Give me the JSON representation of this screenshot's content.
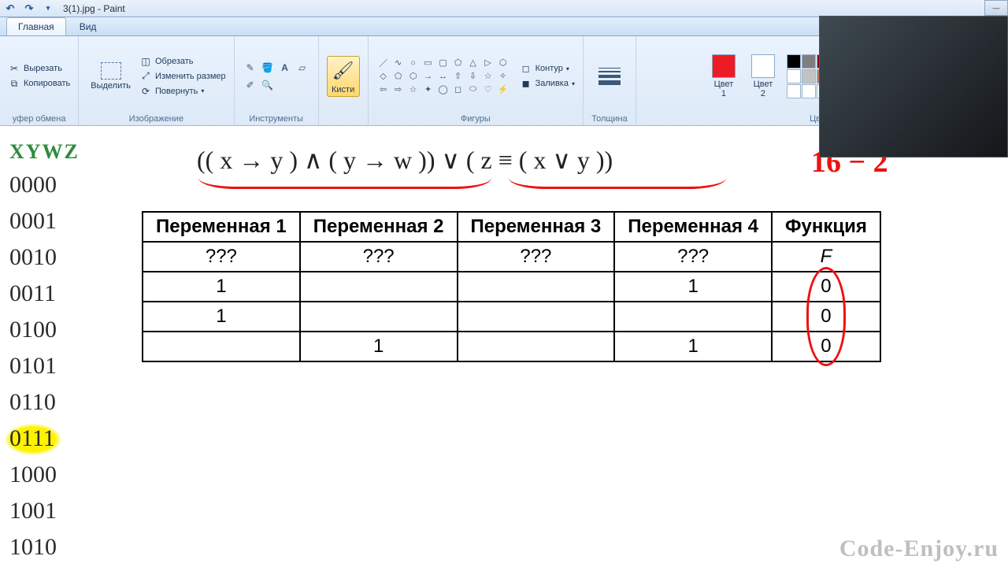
{
  "titlebar": {
    "title": "3(1).jpg - Paint"
  },
  "tabs": {
    "home": "Главная",
    "view": "Вид"
  },
  "ribbon": {
    "clipboard": {
      "label": "уфер обмена",
      "cut": "Вырезать",
      "copy": "Копировать"
    },
    "select": {
      "btn": "Выделить",
      "label": "Изображение",
      "crop": "Обрезать",
      "resize": "Изменить размер",
      "rotate": "Повернуть"
    },
    "tools": {
      "label": "Инструменты"
    },
    "brushes": {
      "btn": "Кисти"
    },
    "shapes": {
      "label": "Фигуры",
      "outline": "Контур",
      "fill": "Заливка"
    },
    "thickness": {
      "label": "Толщина"
    },
    "colors": {
      "c1": "Цвет\n1",
      "c2": "Цвет\n2",
      "label": "Цвета"
    }
  },
  "palette_row1": [
    "#000000",
    "#7f7f7f",
    "#880015",
    "#ed1c24",
    "#ff7f27",
    "#fff200",
    "#22b14c",
    "#00a2e8",
    "#3f48cc",
    "#a349a4"
  ],
  "palette_row2": [
    "#ffffff",
    "#c3c3c3",
    "#b97a57",
    "#ffaec9",
    "#ffc90e",
    "#efe4b0",
    "#b5e61d",
    "#99d9ea",
    "#7092be",
    "#c8bfe7"
  ],
  "leftcol": {
    "header": "XYWZ",
    "rows": [
      "0000",
      "0001",
      "0010",
      "0011",
      "0100",
      "0101",
      "0110",
      "0111",
      "1000",
      "1001",
      "1010"
    ],
    "highlighted_index": 7
  },
  "formula": "(( x → y ) ∧ ( y → w )) ∨ ( z ≡ ( x ∨ y ))",
  "rednote": "16 − 2",
  "table": {
    "headers": [
      "Переменная 1",
      "Переменная 2",
      "Переменная 3",
      "Переменная 4",
      "Функция"
    ],
    "rows": [
      [
        "???",
        "???",
        "???",
        "???",
        "F"
      ],
      [
        "1",
        "",
        "",
        "1",
        "0"
      ],
      [
        "1",
        "",
        "",
        "",
        "0"
      ],
      [
        "",
        "1",
        "",
        "1",
        "0"
      ]
    ]
  },
  "watermark": "Code-Enjoy.ru"
}
